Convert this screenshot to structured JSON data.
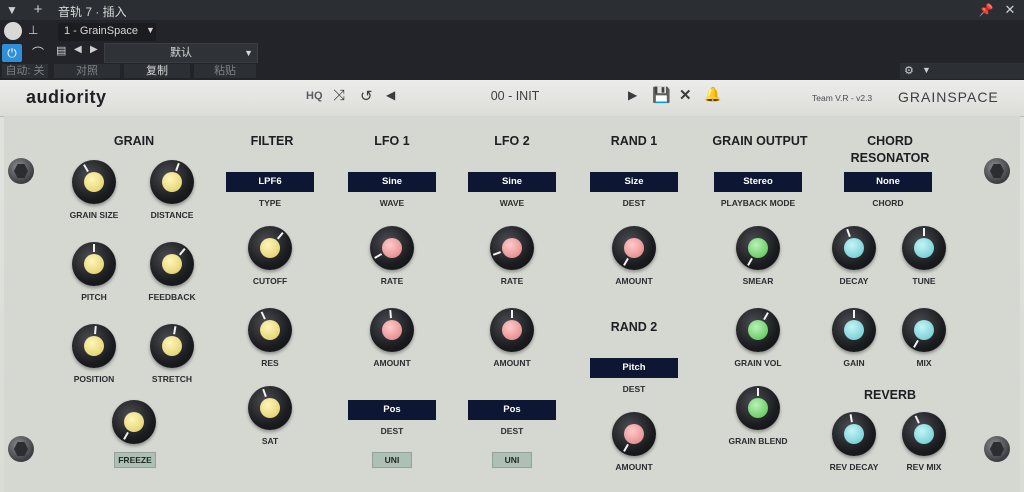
{
  "host": {
    "title": "音轨 7 · 插入",
    "preset_tab": "1 - GrainSpace",
    "preset_name": "默认",
    "auto_label": "自动: 关",
    "compare_label": "对照",
    "copy_label": "复制",
    "paste_label": "粘贴"
  },
  "plugin": {
    "brand": "audiority",
    "hq_label": "HQ",
    "preset": "00 - INIT",
    "team": "Team V.R - v2.3",
    "product": "GRAINSPACE"
  },
  "sections": {
    "grain": {
      "title": "GRAIN",
      "grain_size": "GRAIN SIZE",
      "distance": "DISTANCE",
      "pitch": "PITCH",
      "feedback": "FEEDBACK",
      "position": "POSITION",
      "stretch": "STRETCH",
      "freeze": "FREEZE"
    },
    "filter": {
      "title": "FILTER",
      "type_value": "LPF6",
      "type_label": "TYPE",
      "cutoff": "CUTOFF",
      "res": "RES",
      "sat": "SAT"
    },
    "lfo1": {
      "title": "LFO 1",
      "wave_value": "Sine",
      "wave_label": "WAVE",
      "rate": "RATE",
      "amount": "AMOUNT",
      "dest_value": "Pos",
      "dest_label": "DEST",
      "uni": "UNI"
    },
    "lfo2": {
      "title": "LFO 2",
      "wave_value": "Sine",
      "wave_label": "WAVE",
      "rate": "RATE",
      "amount": "AMOUNT",
      "dest_value": "Pos",
      "dest_label": "DEST",
      "uni": "UNI"
    },
    "rand1": {
      "title": "RAND 1",
      "dest_value": "Size",
      "dest_label": "DEST",
      "amount": "AMOUNT"
    },
    "rand2": {
      "title": "RAND 2",
      "dest_value": "Pitch",
      "dest_label": "DEST",
      "amount": "AMOUNT"
    },
    "grain_output": {
      "title": "GRAIN OUTPUT",
      "mode_value": "Stereo",
      "mode_label": "PLAYBACK MODE",
      "smear": "SMEAR",
      "grain_vol": "GRAIN VOL",
      "grain_blend": "GRAIN BLEND"
    },
    "chord": {
      "title_1": "CHORD",
      "title_2": "RESONATOR",
      "chord_value": "None",
      "chord_label": "CHORD",
      "decay": "DECAY",
      "tune": "TUNE",
      "gain": "GAIN",
      "mix": "MIX"
    },
    "reverb": {
      "title": "REVERB",
      "rev_decay": "REV DECAY",
      "rev_mix": "REV MIX"
    }
  },
  "colors": {
    "yellow": "#e7d77a",
    "pink": "#e89595",
    "green": "#6fcf6a",
    "cyan": "#7fd3d9",
    "display_bg": "#0d1733",
    "host_accent": "#2f8fd8"
  }
}
